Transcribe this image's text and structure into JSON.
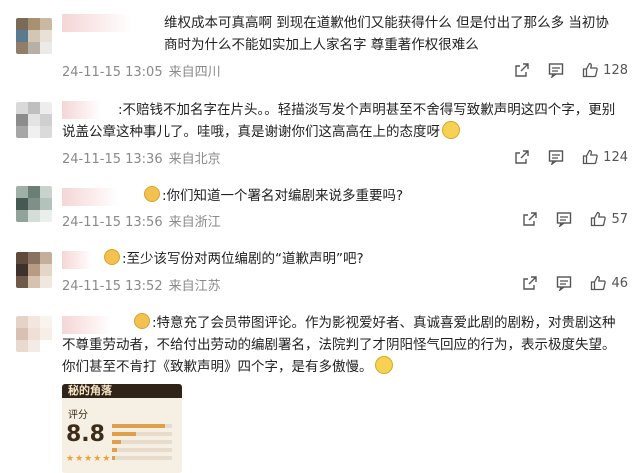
{
  "comments": [
    {
      "text": "维权成本可真高啊 到现在道歉他们又能获得什么 但是付出了那么多 当初协商时为什么不能如实加上人家名字 尊重著作权很难么",
      "date": "24-11-15 13:05",
      "location": "来自四川",
      "likes": "128"
    },
    {
      "text": ":不赔钱不加名字在片头。。轻描淡写发个声明甚至不舍得写致歉声明这四个字，更别说盖公章这种事儿了。哇哦，真是谢谢你们这高高在上的态度呀",
      "date": "24-11-15 13:36",
      "location": "来自北京",
      "likes": "124"
    },
    {
      "text": ":你们知道一个署名对编剧来说多重要吗?",
      "date": "24-11-15 13:56",
      "location": "来自浙江",
      "likes": "57"
    },
    {
      "text": ":至少该写份对两位编剧的“道歉声明”吧?",
      "date": "24-11-15 13:52",
      "location": "来自江苏",
      "likes": "46"
    },
    {
      "text": ":特意充了会员带图评论。作为影视爱好者、真诚喜爱此剧的剧粉，对贵剧这种不尊重劳动者，不给付出劳动的编剧署名，法院判了才阴阳怪气回应的行为，表示极度失望。你们甚至不肯打《致歉声明》四个字，是有多傲慢。"
    }
  ],
  "image_card": {
    "title": "秘的角落",
    "score_label": "评分",
    "score": "8.8",
    "stars": "★★★★★"
  },
  "colors": {
    "text": "#222222",
    "meta": "#8a8a8a",
    "icon": "#555555"
  },
  "icons": [
    "share-icon",
    "comment-icon",
    "like-icon",
    "emoji-badge-icon",
    "smile-emoji-icon"
  ]
}
